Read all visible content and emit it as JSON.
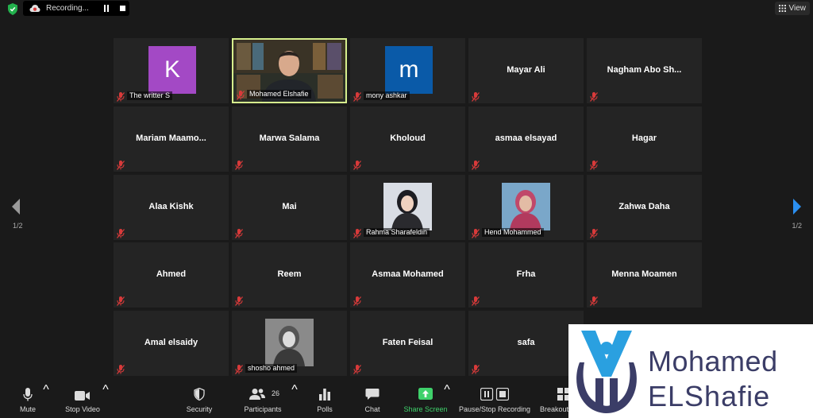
{
  "top_bar": {
    "recording_text": "Recording...",
    "view_label": "View"
  },
  "pagination": {
    "left": "1/2",
    "right": "1/2"
  },
  "participants": [
    {
      "name": "The writter S",
      "display": "avatar",
      "avatar_letter": "K",
      "avatar_color": "#a349c5"
    },
    {
      "name": "Mohamed Elshafie",
      "display": "video",
      "active_speaker": true
    },
    {
      "name": "mony ashkar",
      "display": "avatar",
      "avatar_letter": "m",
      "avatar_color": "#0a5aa8"
    },
    {
      "name": "Mayar Ali",
      "display": "name"
    },
    {
      "name": "Nagham  Abo Sh...",
      "display": "name"
    },
    {
      "name": "Mariam  Maamo...",
      "display": "name"
    },
    {
      "name": "Marwa Salama",
      "display": "name"
    },
    {
      "name": "Kholoud",
      "display": "name"
    },
    {
      "name": "asmaa elsayad",
      "display": "name"
    },
    {
      "name": "Hagar",
      "display": "name"
    },
    {
      "name": "Alaa Kishk",
      "display": "name"
    },
    {
      "name": "Mai",
      "display": "name"
    },
    {
      "name": "Rahma Sharafeldin",
      "display": "photo"
    },
    {
      "name": "Hend Mohammed",
      "display": "photo"
    },
    {
      "name": "Zahwa Daha",
      "display": "name"
    },
    {
      "name": "Ahmed",
      "display": "name"
    },
    {
      "name": "Reem",
      "display": "name"
    },
    {
      "name": "Asmaa Mohamed",
      "display": "name"
    },
    {
      "name": "Frha",
      "display": "name"
    },
    {
      "name": "Menna Moamen",
      "display": "name"
    },
    {
      "name": "Amal elsaidy",
      "display": "name"
    },
    {
      "name": "shosho ahmed",
      "display": "photo"
    },
    {
      "name": "Faten Feisal",
      "display": "name"
    },
    {
      "name": "safa",
      "display": "name"
    }
  ],
  "toolbar": {
    "mute": "Mute",
    "stop_video": "Stop Video",
    "security": "Security",
    "participants": "Participants",
    "participant_count": "26",
    "polls": "Polls",
    "chat": "Chat",
    "share_screen": "Share Screen",
    "pause_stop_recording": "Pause/Stop Recording",
    "breakout": "Breakout"
  },
  "watermark": {
    "first": "Mohamed",
    "last": "ELShafie"
  },
  "colors": {
    "background": "#1a1a1a",
    "tile": "#242424",
    "active_border": "#d6ef8d",
    "share_green": "#3fd16b",
    "muted_red": "#d83a3a",
    "logo_navy": "#3b3d67",
    "logo_blue": "#2aa0e0"
  }
}
